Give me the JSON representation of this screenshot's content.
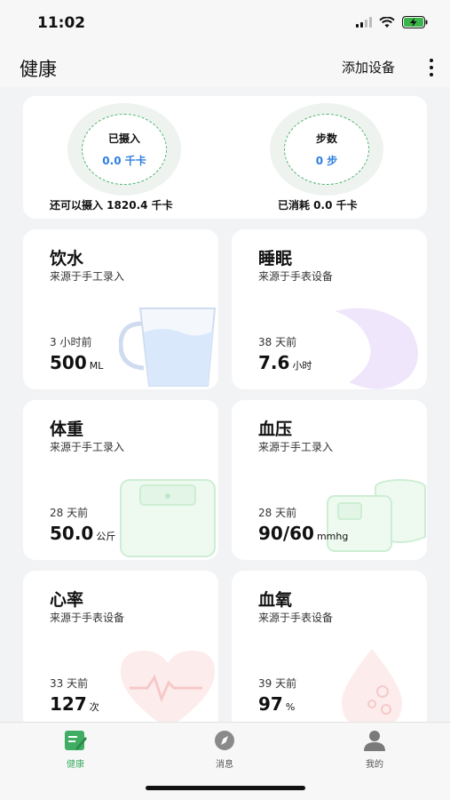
{
  "status_bar": {
    "time": "11:02"
  },
  "nav": {
    "title": "健康",
    "add_device": "添加设备"
  },
  "summary": {
    "intake": {
      "label": "已摄入",
      "value": "0.0 千卡",
      "note": "还可以摄入 1820.4 千卡"
    },
    "steps": {
      "label": "步数",
      "value": "0 步",
      "note": "已消耗 0.0 千卡"
    }
  },
  "cards": {
    "water": {
      "title": "饮水",
      "source": "来源于手工录入",
      "time": "3 小时前",
      "value": "500",
      "unit": "ML"
    },
    "sleep": {
      "title": "睡眠",
      "source": "来源于手表设备",
      "time": "38 天前",
      "value": "7.6",
      "unit": "小时"
    },
    "weight": {
      "title": "体重",
      "source": "来源于手工录入",
      "time": "28 天前",
      "value": "50.0",
      "unit": "公斤"
    },
    "blood_pressure": {
      "title": "血压",
      "source": "来源于手工录入",
      "time": "28 天前",
      "value": "90/60",
      "unit": "mmhg"
    },
    "heart_rate": {
      "title": "心率",
      "source": "来源于手表设备",
      "time": "33 天前",
      "value": "127",
      "unit": "次"
    },
    "blood_oxygen": {
      "title": "血氧",
      "source": "来源于手表设备",
      "time": "39 天前",
      "value": "97",
      "unit": "%"
    }
  },
  "tabs": [
    {
      "label": "健康",
      "icon": "notebook-pen-icon",
      "active": true
    },
    {
      "label": "消息",
      "icon": "compass-icon",
      "active": false
    },
    {
      "label": "我的",
      "icon": "user-icon",
      "active": false
    }
  ],
  "colors": {
    "accent_green": "#3fae63",
    "value_blue": "#2f7fe0"
  }
}
